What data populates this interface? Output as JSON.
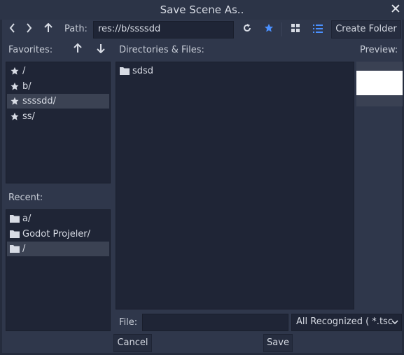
{
  "dialog": {
    "title": "Save Scene As..",
    "close_glyph": "✕"
  },
  "toolbar": {
    "path_label": "Path:",
    "path_value": "res://b/ssssdd",
    "create_folder_label": "Create Folder"
  },
  "favorites": {
    "label": "Favorites:",
    "items": [
      {
        "label": "/"
      },
      {
        "label": "b/"
      },
      {
        "label": "ssssdd/"
      },
      {
        "label": "ss/"
      }
    ]
  },
  "recent": {
    "label": "Recent:",
    "items": [
      {
        "label": "a/"
      },
      {
        "label": "Godot Projeler/"
      },
      {
        "label": "/"
      }
    ]
  },
  "files": {
    "label": "Directories & Files:",
    "items": [
      {
        "label": "sdsd"
      }
    ]
  },
  "preview": {
    "label": "Preview:"
  },
  "footer": {
    "file_label": "File:",
    "file_value": "",
    "filter_value": "All Recognized ( *.tsc"
  },
  "buttons": {
    "cancel": "Cancel",
    "save": "Save"
  },
  "colors": {
    "accent": "#4a90ff",
    "selection": "#3b4253",
    "panel": "#1f2536",
    "background": "#2f374b"
  }
}
